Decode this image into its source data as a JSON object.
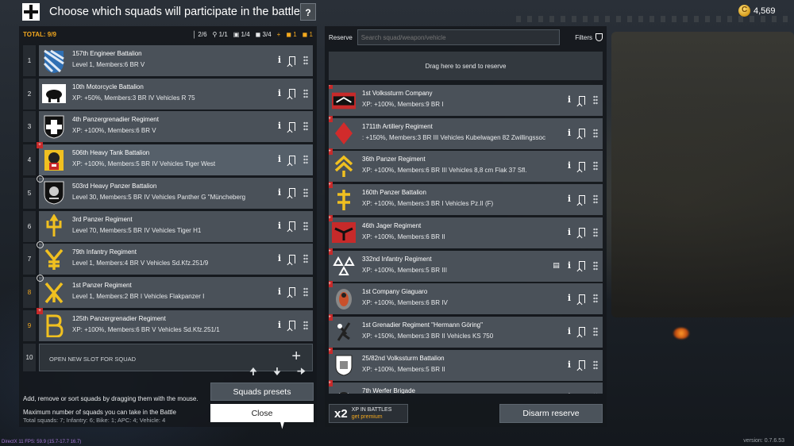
{
  "header": {
    "title": "Choose which squads will participate in the battle",
    "help": "?"
  },
  "gold": {
    "amount": "4,569"
  },
  "left": {
    "total": "TOTAL: 9/9",
    "counts": [
      "2/6",
      "1/1",
      "1/4",
      "3/4",
      "1",
      "1"
    ],
    "squads": [
      {
        "num": "1",
        "name": "157th Engineer Battalion",
        "info": "Level 1, Members:6 BR V",
        "num_orange": false,
        "badge": "",
        "light": false
      },
      {
        "num": "2",
        "name": "10th Motorcycle Battalion",
        "info": "XP: +50%, Members:3 BR IV Vehicles R 75",
        "num_orange": false,
        "badge": "",
        "light": false
      },
      {
        "num": "3",
        "name": "4th Panzergrenadier Regiment",
        "info": "XP: +100%, Members:6 BR V",
        "num_orange": false,
        "badge": "",
        "light": false
      },
      {
        "num": "4",
        "name": "506th Heavy Tank Battalion",
        "info": "XP: +100%, Members:5 BR IV Vehicles Tiger West",
        "num_orange": false,
        "badge": "red",
        "light": true
      },
      {
        "num": "5",
        "name": "503rd Heavy Panzer Battalion",
        "info": "Level 30, Members:5 BR IV Vehicles Panther G \"Müncheberg",
        "num_orange": false,
        "badge": "gray",
        "light": false
      },
      {
        "num": "6",
        "name": "3rd Panzer Regiment",
        "info": "Level 70, Members:5 BR IV Vehicles Tiger H1",
        "num_orange": false,
        "badge": "",
        "light": false
      },
      {
        "num": "7",
        "name": "79th Infantry Regiment",
        "info": "Level 1, Members:4 BR V Vehicles Sd.Kfz.251/9",
        "num_orange": false,
        "badge": "gray",
        "light": false
      },
      {
        "num": "8",
        "name": "1st Panzer Regiment",
        "info": "Level 1, Members:2 BR I Vehicles Flakpanzer I",
        "num_orange": true,
        "badge": "gray",
        "light": false
      },
      {
        "num": "9",
        "name": "125th Panzergrenadier Regiment",
        "info": "XP: +100%, Members:6 BR V Vehicles Sd.Kfz.251/1",
        "num_orange": true,
        "badge": "red",
        "light": false
      }
    ],
    "new_slot": {
      "num": "10",
      "label": "OPEN NEW SLOT FOR SQUAD"
    },
    "hint": "Add, remove or sort squads by dragging them with the mouse.",
    "max_squads": "Maximum number of squads you can take in the Battle",
    "total_squads": "Total squads: 7; Infantry: 6; Bike: 1; APC: 4; Vehicle: 4",
    "presets_label": "Squads presets",
    "close_label": "Close"
  },
  "right": {
    "reserve_label": "Reserve",
    "search_placeholder": "Search squad/weapon/vehicle",
    "filters_label": "Filters",
    "dropzone": "Drag here to send to reserve",
    "squads": [
      {
        "name": "1st Volkssturm Company",
        "info": "XP: +100%, Members:9 BR I",
        "book": false
      },
      {
        "name": "1711th Artillery Regiment",
        "info": ": +150%, Members:3 BR III Vehicles Kubelwagen 82 Zwillingssoc",
        "book": false
      },
      {
        "name": "36th Panzer Regiment",
        "info": "XP: +100%, Members:6 BR III Vehicles 8,8 cm Flak 37 Sfl.",
        "book": false
      },
      {
        "name": "160th Panzer Battalion",
        "info": "XP: +100%, Members:3 BR I Vehicles Pz.II (F)",
        "book": false
      },
      {
        "name": "46th Jager Regiment",
        "info": "XP: +100%, Members:6 BR II",
        "book": false
      },
      {
        "name": "332nd Infantry Regiment",
        "info": "XP: +100%, Members:5 BR III",
        "book": true
      },
      {
        "name": "1st Company Giaguaro",
        "info": "XP: +100%, Members:6 BR IV",
        "book": false
      },
      {
        "name": "1st Grenadier Regiment \"Hermann Göring\"",
        "info": "XP: +150%, Members:3 BR II Vehicles KS 750",
        "book": false
      },
      {
        "name": "25/82nd Volkssturm Battalion",
        "info": "XP: +100%, Members:5 BR II",
        "book": false
      },
      {
        "name": "7th Werfer Brigade",
        "info": "",
        "book": false
      }
    ],
    "xp": {
      "mult": "x2",
      "line1": "XP IN BATTLES",
      "line2": "get premium"
    },
    "disarm_label": "Disarm reserve"
  },
  "footer": {
    "fps": "DirectX 11 FPS: 59.9 (15.7-17.7 16.7)",
    "version": "version: 0.7.6.53"
  },
  "colors": {
    "accent": "#f3a81e",
    "card": "#4a5159",
    "badge": "#c72a2a"
  }
}
